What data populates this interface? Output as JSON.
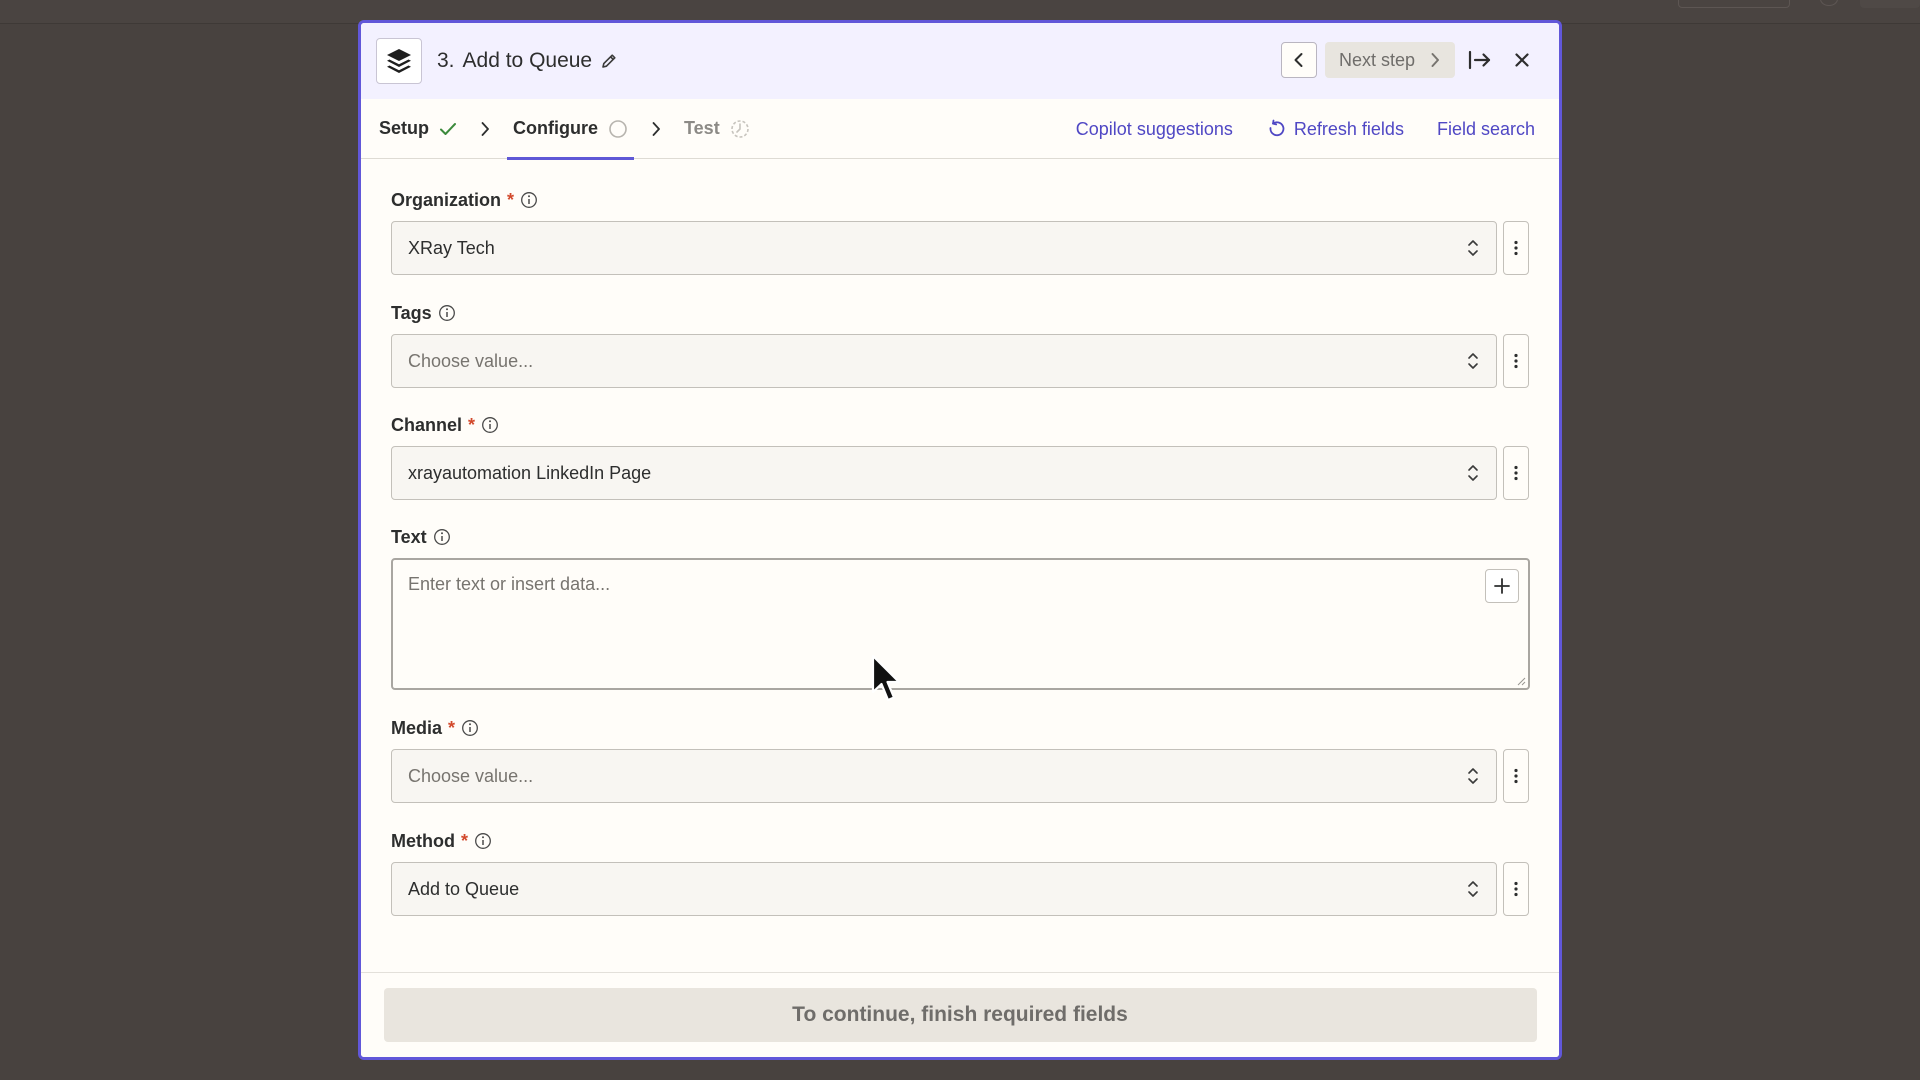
{
  "colors": {
    "backdrop": "#48423f",
    "modal_border": "#6157d9",
    "header_bg": "#f3f1ff",
    "link": "#4f47c4",
    "required": "#d2492c",
    "success_check": "#3c8a3c"
  },
  "header": {
    "app_icon": "buffer-stack-icon",
    "step_number": "3.",
    "title": "Add to Queue",
    "next_step_label": "Next step"
  },
  "tabs": [
    {
      "label": "Setup",
      "status": "complete"
    },
    {
      "label": "Configure",
      "status": "active"
    },
    {
      "label": "Test",
      "status": "pending"
    }
  ],
  "tab_links": {
    "copilot": "Copilot suggestions",
    "refresh": "Refresh fields",
    "field_search": "Field search"
  },
  "fields": {
    "organization": {
      "label": "Organization",
      "required": true,
      "value": "XRay Tech"
    },
    "tags": {
      "label": "Tags",
      "required": false,
      "placeholder": "Choose value..."
    },
    "channel": {
      "label": "Channel",
      "required": true,
      "value": "xrayautomation LinkedIn Page"
    },
    "text": {
      "label": "Text",
      "required": false,
      "placeholder": "Enter text or insert data..."
    },
    "media": {
      "label": "Media",
      "required": true,
      "placeholder": "Choose value..."
    },
    "method": {
      "label": "Method",
      "required": true,
      "value": "Add to Queue"
    }
  },
  "required_marker": "*",
  "footer": {
    "cta_label": "To continue, finish required fields"
  }
}
